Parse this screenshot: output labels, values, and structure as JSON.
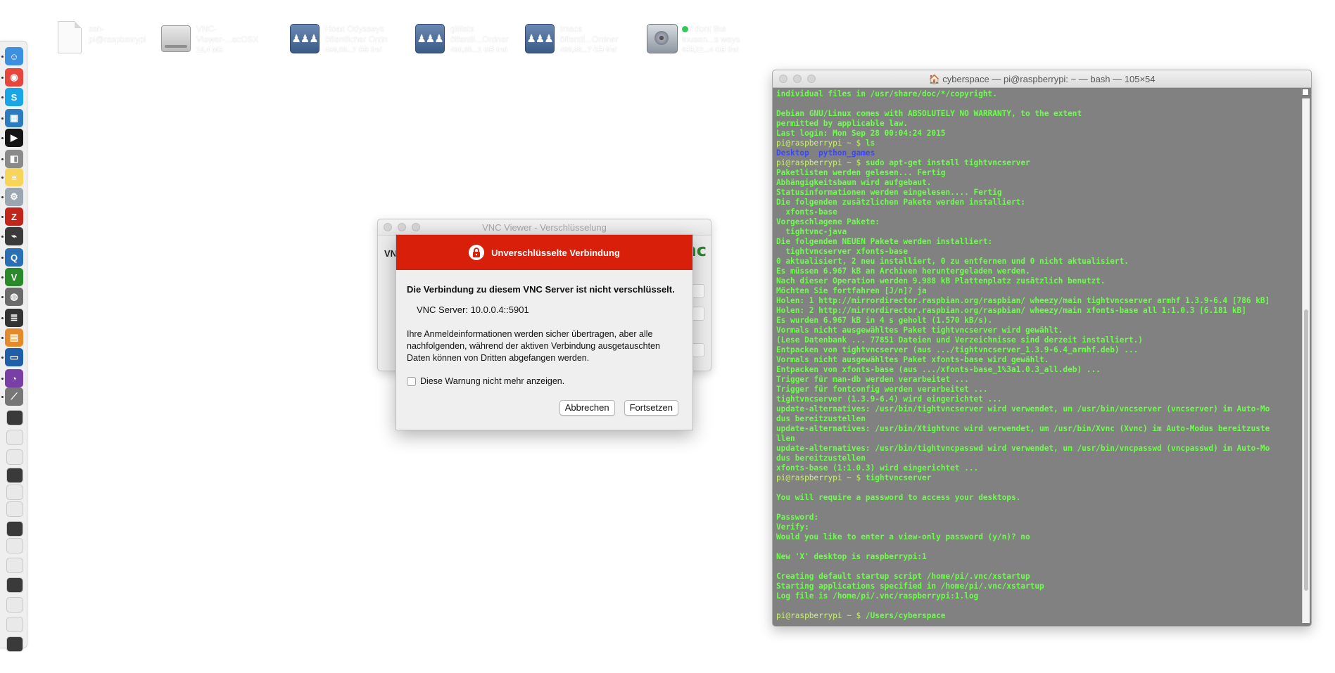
{
  "desktop": {
    "icons": [
      {
        "line1": "ssh-",
        "line2": "pi@raspberrypi",
        "sub": ""
      },
      {
        "line1": "VNC-",
        "line2": "Viewer-...acOSX",
        "sub": "18,4 MB"
      },
      {
        "line1": "Hoax Odysseys",
        "line2": "öffentlicher Ordn",
        "sub": "498,88...7 GB frei"
      },
      {
        "line1": "gitlists",
        "line2": "öffentli...Ordner",
        "sub": "498,88...1 GB frei"
      },
      {
        "line1": "imacs",
        "line2": "öffentli...Ordner",
        "sub": "498,88...7 GB frei"
      },
      {
        "line1": "i dont like",
        "line2": "tousen...s ways",
        "sub": "639,22...4 GB frei"
      }
    ]
  },
  "vnc_window": {
    "title": "VNC Viewer - Verschlüsselung",
    "partial_label": "VN",
    "logo": "nc"
  },
  "alert": {
    "header": "Unverschlüsselte Verbindung",
    "heading": "Die Verbindung zu diesem VNC Server ist nicht verschlüsselt.",
    "server": "VNC Server: 10.0.0.4::5901",
    "description": "Ihre Anmeldeinformationen werden sicher übertragen, aber alle nachfolgenden, während der aktiven Verbindung ausgetauschten Daten können von Dritten abgefangen werden.",
    "checkbox_label": "Diese Warnung nicht mehr anzeigen.",
    "cancel": "Abbrechen",
    "continue": "Fortsetzen",
    "accent": "#d81f0a"
  },
  "terminal": {
    "title": "🏠 cyberspace — pi@raspberrypi: ~ — bash — 105×54",
    "background": "#818181",
    "text_color": "#6cff4a",
    "lines": [
      {
        "t": "individual files in /usr/share/doc/*/copyright."
      },
      {
        "t": ""
      },
      {
        "t": "Debian GNU/Linux comes with ABSOLUTELY NO WARRANTY, to the extent"
      },
      {
        "t": "permitted by applicable law."
      },
      {
        "t": "Last login: Mon Sep 28 00:04:24 2015"
      },
      {
        "p": "pi@raspberrypi ~ $ ",
        "t": "ls"
      },
      {
        "d": "Desktop  python_games"
      },
      {
        "p": "pi@raspberrypi ~ $ ",
        "t": "sudo apt-get install tightvncserver"
      },
      {
        "t": "Paketlisten werden gelesen... Fertig"
      },
      {
        "t": "Abhängigkeitsbaum wird aufgebaut."
      },
      {
        "t": "Statusinformationen werden eingelesen.... Fertig"
      },
      {
        "t": "Die folgenden zusätzlichen Pakete werden installiert:"
      },
      {
        "t": "  xfonts-base"
      },
      {
        "t": "Vorgeschlagene Pakete:"
      },
      {
        "t": "  tightvnc-java"
      },
      {
        "t": "Die folgenden NEUEN Pakete werden installiert:"
      },
      {
        "t": "  tightvncserver xfonts-base"
      },
      {
        "t": "0 aktualisiert, 2 neu installiert, 0 zu entfernen und 0 nicht aktualisiert."
      },
      {
        "t": "Es müssen 6.967 kB an Archiven heruntergeladen werden."
      },
      {
        "t": "Nach dieser Operation werden 9.988 kB Plattenplatz zusätzlich benutzt."
      },
      {
        "t": "Möchten Sie fortfahren [J/n]? ja"
      },
      {
        "t": "Holen: 1 http://mirrordirector.raspbian.org/raspbian/ wheezy/main tightvncserver armhf 1.3.9-6.4 [786 kB]"
      },
      {
        "t": "Holen: 2 http://mirrordirector.raspbian.org/raspbian/ wheezy/main xfonts-base all 1:1.0.3 [6.181 kB]"
      },
      {
        "t": "Es wurden 6.967 kB in 4 s geholt (1.570 kB/s)."
      },
      {
        "t": "Vormals nicht ausgewähltes Paket tightvncserver wird gewählt."
      },
      {
        "t": "(Lese Datenbank ... 77851 Dateien und Verzeichnisse sind derzeit installiert.)"
      },
      {
        "t": "Entpacken von tightvncserver (aus .../tightvncserver_1.3.9-6.4_armhf.deb) ..."
      },
      {
        "t": "Vormals nicht ausgewähltes Paket xfonts-base wird gewählt."
      },
      {
        "t": "Entpacken von xfonts-base (aus .../xfonts-base_1%3a1.0.3_all.deb) ..."
      },
      {
        "t": "Trigger für man-db werden verarbeitet ..."
      },
      {
        "t": "Trigger für fontconfig werden verarbeitet ..."
      },
      {
        "t": "tightvncserver (1.3.9-6.4) wird eingerichtet ..."
      },
      {
        "t": "update-alternatives: /usr/bin/tightvncserver wird verwendet, um /usr/bin/vncserver (vncserver) im Auto-Mo"
      },
      {
        "t": "dus bereitzustellen"
      },
      {
        "t": "update-alternatives: /usr/bin/Xtightvnc wird verwendet, um /usr/bin/Xvnc (Xvnc) im Auto-Modus bereitzuste"
      },
      {
        "t": "llen"
      },
      {
        "t": "update-alternatives: /usr/bin/tightvncpasswd wird verwendet, um /usr/bin/vncpasswd (vncpasswd) im Auto-Mo"
      },
      {
        "t": "dus bereitzustellen"
      },
      {
        "t": "xfonts-base (1:1.0.3) wird eingerichtet ..."
      },
      {
        "p": "pi@raspberrypi ~ $ ",
        "t": "tightvncserver"
      },
      {
        "t": ""
      },
      {
        "t": "You will require a password to access your desktops."
      },
      {
        "t": ""
      },
      {
        "t": "Password:"
      },
      {
        "t": "Verify:"
      },
      {
        "t": "Would you like to enter a view-only password (y/n)? no"
      },
      {
        "t": ""
      },
      {
        "t": "New 'X' desktop is raspberrypi:1"
      },
      {
        "t": ""
      },
      {
        "t": "Creating default startup script /home/pi/.vnc/xstartup"
      },
      {
        "t": "Starting applications specified in /home/pi/.vnc/xstartup"
      },
      {
        "t": "Log file is /home/pi/.vnc/raspberrypi:1.log"
      },
      {
        "t": ""
      },
      {
        "p": "pi@raspberrypi ~ $ ",
        "t": "/Users/cyberspace"
      }
    ]
  },
  "dock": {
    "apps": [
      {
        "name": "finder-icon",
        "color": "#3d8fe0",
        "glyph": "☺"
      },
      {
        "name": "chrome-icon",
        "color": "#e8453c",
        "glyph": "◉"
      },
      {
        "name": "skype-icon",
        "color": "#1aa5e6",
        "glyph": "S"
      },
      {
        "name": "network-tool-icon",
        "color": "#2c7bbf",
        "glyph": "▦"
      },
      {
        "name": "iterm-icon",
        "color": "#151515",
        "glyph": "▶"
      },
      {
        "name": "preview-icon",
        "color": "#8a8a8a",
        "glyph": "◧"
      },
      {
        "name": "notes-icon",
        "color": "#f6d55a",
        "glyph": "≡"
      },
      {
        "name": "settings-icon",
        "color": "#9aa6b2",
        "glyph": "⚙"
      },
      {
        "name": "filezilla-icon",
        "color": "#c0261b",
        "glyph": "Z"
      },
      {
        "name": "wireshark-icon",
        "color": "#3a3a3a",
        "glyph": "⌁"
      },
      {
        "name": "quicktime-icon",
        "color": "#2a6fb3",
        "glyph": "Q"
      },
      {
        "name": "vnc-icon",
        "color": "#2a8a2a",
        "glyph": "V"
      },
      {
        "name": "disk-utility-icon",
        "color": "#6b6b6b",
        "glyph": "◍"
      },
      {
        "name": "console-icon",
        "color": "#333333",
        "glyph": "≣"
      },
      {
        "name": "calculator-icon",
        "color": "#e48a2a",
        "glyph": "▤"
      },
      {
        "name": "textedit-icon",
        "color": "#1f5ea8",
        "glyph": "▭"
      },
      {
        "name": "github-icon",
        "color": "#7a3fa6",
        "glyph": "◔"
      },
      {
        "name": "grapher-icon",
        "color": "#777777",
        "glyph": "⟋"
      }
    ]
  }
}
